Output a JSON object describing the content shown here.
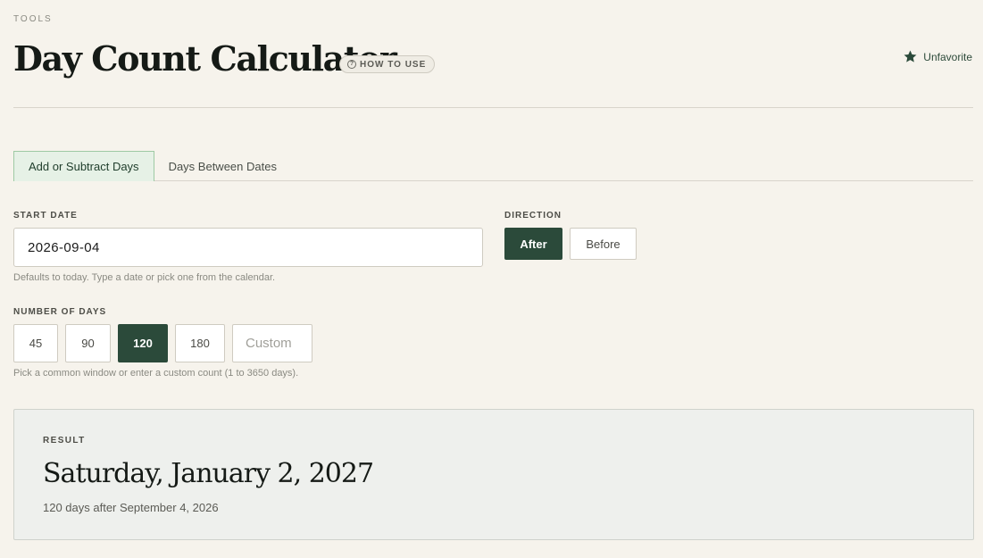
{
  "header": {
    "eyebrow": "TOOLS",
    "title": "Day Count Calculator",
    "how_to_use": "HOW TO USE",
    "favorite_label": "Unfavorite"
  },
  "tabs": [
    {
      "label": "Add or Subtract Days",
      "active": true
    },
    {
      "label": "Days Between Dates",
      "active": false
    }
  ],
  "start_date": {
    "label": "START DATE",
    "value": "2026-09-04",
    "hint": "Defaults to today. Type a date or pick one from the calendar."
  },
  "direction": {
    "label": "DIRECTION",
    "options": [
      "After",
      "Before"
    ],
    "selected": "After"
  },
  "days": {
    "label": "NUMBER OF DAYS",
    "options": [
      "45",
      "90",
      "120",
      "180"
    ],
    "selected": "120",
    "custom_placeholder": "Custom",
    "custom_value": "",
    "hint": "Pick a common window or enter a custom count (1 to 3650 days)."
  },
  "result": {
    "label": "RESULT",
    "date": "Saturday, January 2, 2027",
    "summary": "120 days after September 4, 2026"
  },
  "colors": {
    "accent": "#2b4a3a",
    "background": "#f6f3ec",
    "tab_active_bg": "#e6f1e6",
    "result_bg": "#eef0ed"
  },
  "icons": {
    "favorite": "star-icon",
    "how_to_use": "question-circle-icon"
  }
}
